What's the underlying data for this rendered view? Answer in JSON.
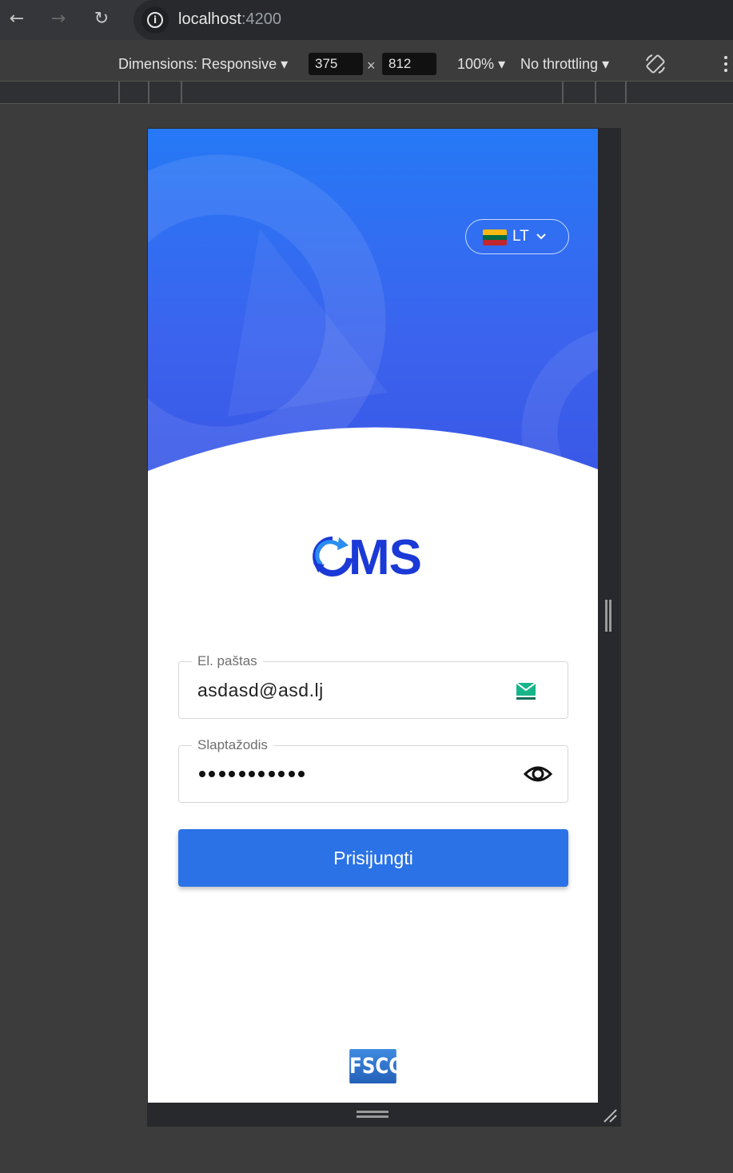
{
  "browser": {
    "url_host": "localhost",
    "url_port": ":4200"
  },
  "devtools": {
    "dimensions_label": "Dimensions: Responsive",
    "width_value": "375",
    "height_value": "812",
    "zoom_label": "100%",
    "throttling_label": "No throttling",
    "times_symbol": "×"
  },
  "app": {
    "language": {
      "code": "LT",
      "flag_colors": [
        "#fdb913",
        "#006a44",
        "#c1272d"
      ]
    },
    "logo_text": "MS",
    "email": {
      "label": "El. paštas",
      "value": "asdasd@asd.lj"
    },
    "password": {
      "label": "Slaptažodis",
      "masked_length": 11
    },
    "submit_label": "Prisijungti",
    "footer_logo": "FSCC"
  },
  "colors": {
    "hero_top": "#2679f6",
    "hero_bottom": "#3a57e6",
    "button": "#2a72e6",
    "logo": "#1b39d6"
  }
}
